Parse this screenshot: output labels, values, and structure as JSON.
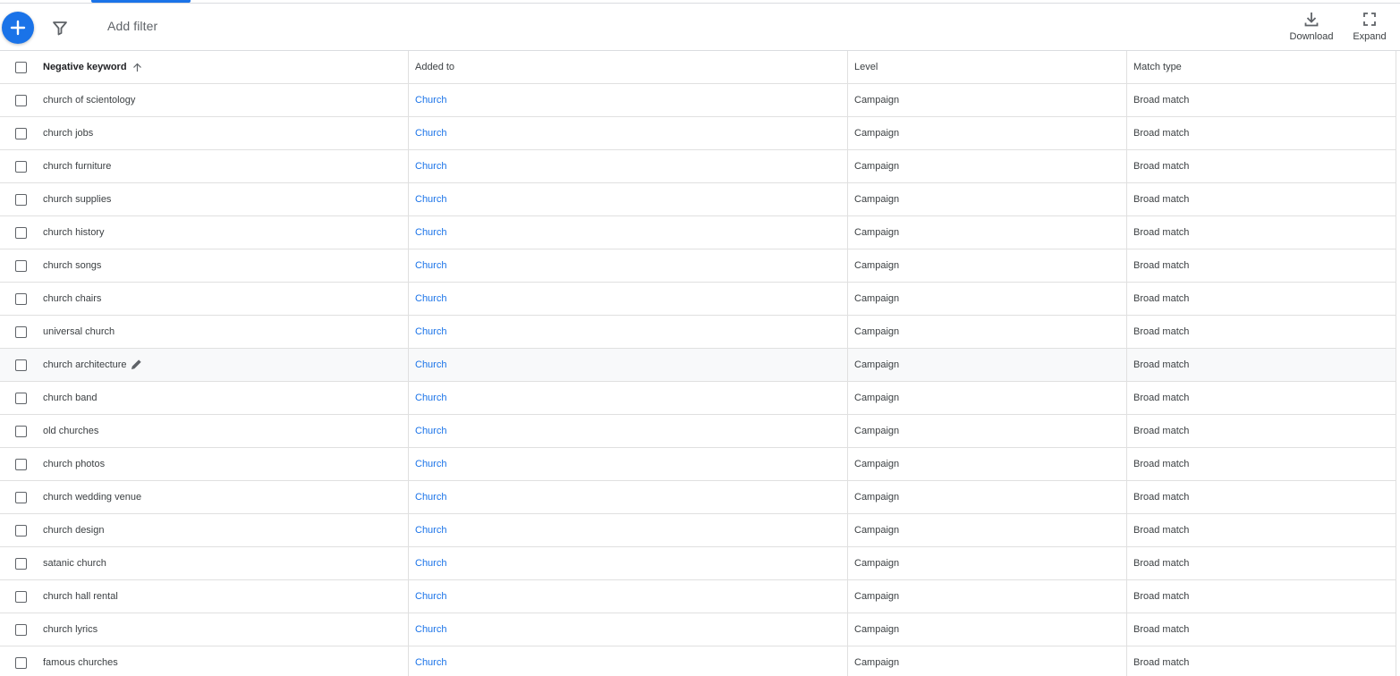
{
  "toolbar": {
    "add_filter_placeholder": "Add filter",
    "download_label": "Download",
    "expand_label": "Expand"
  },
  "colors": {
    "accent": "#1a73e8",
    "text": "#3c4043",
    "divider": "#e0e0e0"
  },
  "table": {
    "headers": {
      "keyword": "Negative keyword",
      "added_to": "Added to",
      "level": "Level",
      "match_type": "Match type"
    },
    "sort": {
      "column": "keyword",
      "direction": "ascending"
    },
    "rows": [
      {
        "keyword": "church of scientology",
        "added_to": "Church",
        "level": "Campaign",
        "match_type": "Broad match"
      },
      {
        "keyword": "church jobs",
        "added_to": "Church",
        "level": "Campaign",
        "match_type": "Broad match"
      },
      {
        "keyword": "church furniture",
        "added_to": "Church",
        "level": "Campaign",
        "match_type": "Broad match"
      },
      {
        "keyword": "church supplies",
        "added_to": "Church",
        "level": "Campaign",
        "match_type": "Broad match"
      },
      {
        "keyword": "church history",
        "added_to": "Church",
        "level": "Campaign",
        "match_type": "Broad match"
      },
      {
        "keyword": "church songs",
        "added_to": "Church",
        "level": "Campaign",
        "match_type": "Broad match"
      },
      {
        "keyword": "church chairs",
        "added_to": "Church",
        "level": "Campaign",
        "match_type": "Broad match"
      },
      {
        "keyword": "universal church",
        "added_to": "Church",
        "level": "Campaign",
        "match_type": "Broad match"
      },
      {
        "keyword": "church architecture",
        "added_to": "Church",
        "level": "Campaign",
        "match_type": "Broad match",
        "hovered": true
      },
      {
        "keyword": "church band",
        "added_to": "Church",
        "level": "Campaign",
        "match_type": "Broad match"
      },
      {
        "keyword": "old churches",
        "added_to": "Church",
        "level": "Campaign",
        "match_type": "Broad match"
      },
      {
        "keyword": "church photos",
        "added_to": "Church",
        "level": "Campaign",
        "match_type": "Broad match"
      },
      {
        "keyword": "church wedding venue",
        "added_to": "Church",
        "level": "Campaign",
        "match_type": "Broad match"
      },
      {
        "keyword": "church design",
        "added_to": "Church",
        "level": "Campaign",
        "match_type": "Broad match"
      },
      {
        "keyword": "satanic church",
        "added_to": "Church",
        "level": "Campaign",
        "match_type": "Broad match"
      },
      {
        "keyword": "church hall rental",
        "added_to": "Church",
        "level": "Campaign",
        "match_type": "Broad match"
      },
      {
        "keyword": "church lyrics",
        "added_to": "Church",
        "level": "Campaign",
        "match_type": "Broad match"
      },
      {
        "keyword": "famous churches",
        "added_to": "Church",
        "level": "Campaign",
        "match_type": "Broad match"
      }
    ]
  }
}
